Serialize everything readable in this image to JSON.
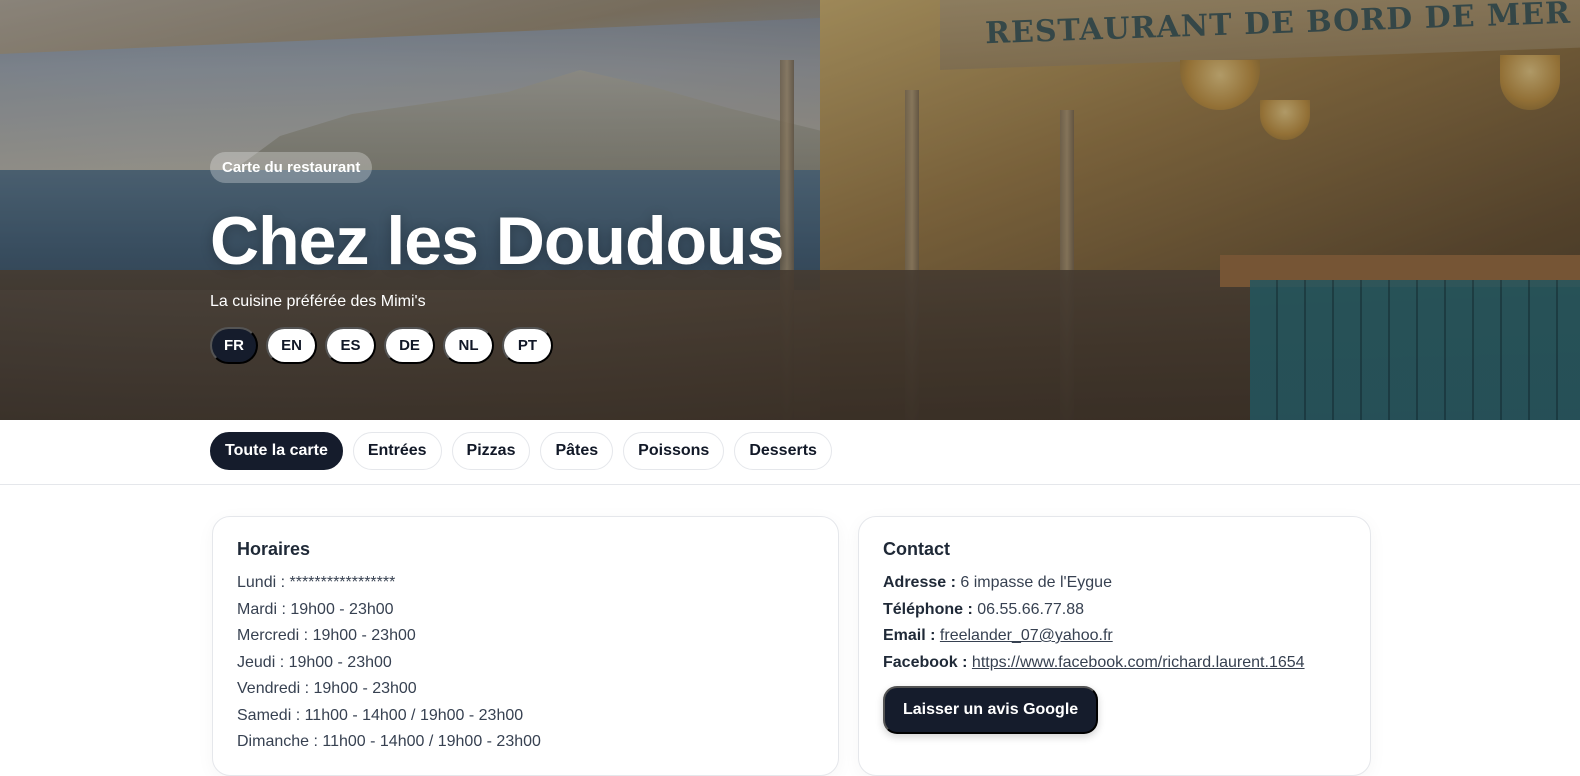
{
  "hero": {
    "sign_text": "RESTAURANT DE BORD DE MER",
    "chip": "Carte du restaurant",
    "title": "Chez les Doudous",
    "subtitle": "La cuisine préférée des Mimi's",
    "languages": [
      "FR",
      "EN",
      "ES",
      "DE",
      "NL",
      "PT"
    ],
    "active_language": "FR"
  },
  "categories": {
    "items": [
      "Toute la carte",
      "Entrées",
      "Pizzas",
      "Pâtes",
      "Poissons",
      "Desserts"
    ],
    "active": "Toute la carte"
  },
  "hours": {
    "title": "Horaires",
    "rows": [
      "Lundi : *****************",
      "Mardi : 19h00 - 23h00",
      "Mercredi : 19h00 - 23h00",
      "Jeudi : 19h00 - 23h00",
      "Vendredi : 19h00 - 23h00",
      "Samedi : 11h00 - 14h00 / 19h00 - 23h00",
      "Dimanche : 11h00 - 14h00 / 19h00 - 23h00"
    ]
  },
  "contact": {
    "title": "Contact",
    "address_label": "Adresse :",
    "address": "6 impasse de l'Eygue",
    "phone_label": "Téléphone :",
    "phone": "06.55.66.77.88",
    "email_label": "Email :",
    "email": "freelander_07@yahoo.fr",
    "facebook_label": "Facebook :",
    "facebook": "https://www.facebook.com/richard.laurent.1654",
    "google_button": "Laisser un avis Google"
  },
  "colors": {
    "dark_accent": "#151c2c",
    "border": "#e5e7eb"
  }
}
